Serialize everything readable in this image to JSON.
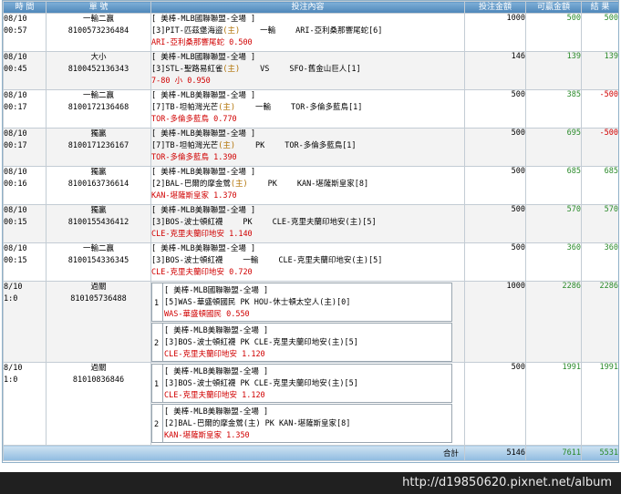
{
  "headers": {
    "time": "時 間",
    "ticket": "單 號",
    "content": "投注內容",
    "stake": "投注金額",
    "win_amount": "可贏金額",
    "result": "結 果"
  },
  "singles": [
    {
      "date": "08/10",
      "time": "00:57",
      "type": "一輸二贏",
      "ticket": "8100573236484",
      "league": "[ 美棒-MLB國聯聯盟-全場 ]",
      "match_pre": "[3]PIT-匹茲堡海盜",
      "home": "(主)",
      "match_mid": "一輸",
      "match_post": "ARI-亞利桑那響尾蛇[6]",
      "pick": "ARI-亞利桑那響尾蛇 0.500",
      "stake": "1000",
      "win": "500",
      "result": "500",
      "neg": false
    },
    {
      "date": "08/10",
      "time": "00:45",
      "type": "大小",
      "ticket": "8100452136343",
      "league": "[ 美棒-MLB國聯聯盟-全場 ]",
      "match_pre": "[3]STL-聖路易紅雀",
      "home": "(主)",
      "match_mid": "VS",
      "match_post": "SFO-舊金山巨人[1]",
      "pick": "7-80 小 0.950",
      "stake": "146",
      "win": "139",
      "result": "139",
      "neg": false
    },
    {
      "date": "08/10",
      "time": "00:17",
      "type": "一輸二贏",
      "ticket": "8100172136468",
      "league": "[ 美棒-MLB美聯聯盟-全場 ]",
      "match_pre": "[7]TB-坦帕灣光芒",
      "home": "(主)",
      "match_mid": "一輸",
      "match_post": "TOR-多倫多藍鳥[1]",
      "pick": "TOR-多倫多藍鳥 0.770",
      "stake": "500",
      "win": "385",
      "result": "-500",
      "neg": true
    },
    {
      "date": "08/10",
      "time": "00:17",
      "type": "獨贏",
      "ticket": "8100171236167",
      "league": "[ 美棒-MLB美聯聯盟-全場 ]",
      "match_pre": "[7]TB-坦帕灣光芒",
      "home": "(主)",
      "match_mid": "PK",
      "match_post": "TOR-多倫多藍鳥[1]",
      "pick": "TOR-多倫多藍鳥 1.390",
      "stake": "500",
      "win": "695",
      "result": "-500",
      "neg": true
    },
    {
      "date": "08/10",
      "time": "00:16",
      "type": "獨贏",
      "ticket": "8100163736614",
      "league": "[ 美棒-MLB美聯聯盟-全場 ]",
      "match_pre": "[2]BAL-巴爾的摩金鶯",
      "home": "(主)",
      "match_mid": "PK",
      "match_post": "KAN-堪薩斯皇家[8]",
      "pick": "KAN-堪薩斯皇家 1.370",
      "stake": "500",
      "win": "685",
      "result": "685",
      "neg": false
    },
    {
      "date": "08/10",
      "time": "00:15",
      "type": "獨贏",
      "ticket": "8100155436412",
      "league": "[ 美棒-MLB美聯聯盟-全場 ]",
      "match_pre": "[3]BOS-波士頓紅襪",
      "home": "",
      "match_mid": "PK",
      "match_post": "CLE-克里夫蘭印地安(主)[5]",
      "pick": "CLE-克里夫蘭印地安 1.140",
      "stake": "500",
      "win": "570",
      "result": "570",
      "neg": false
    },
    {
      "date": "08/10",
      "time": "00:15",
      "type": "一輸二贏",
      "ticket": "8100154336345",
      "league": "[ 美棒-MLB美聯聯盟-全場 ]",
      "match_pre": "[3]BOS-波士頓紅襪",
      "home": "",
      "match_mid": "一輸",
      "match_post": "CLE-克里夫蘭印地安(主)[5]",
      "pick": "CLE-克里夫蘭印地安 0.720",
      "stake": "500",
      "win": "360",
      "result": "360",
      "neg": false
    }
  ],
  "parlays": [
    {
      "date": "8/10",
      "sub": "1:0",
      "type": "過關",
      "ticket": "810105736488",
      "stake": "1000",
      "win": "2286",
      "result": "2286",
      "legs": [
        {
          "n": "1",
          "league": "[ 美棒-MLB國聯聯盟-全場 ]",
          "match": "[5]WAS-華盛頓國民   PK   HOU-休士頓太空人(主)[0]",
          "pick": "WAS-華盛頓國民  0.550"
        },
        {
          "n": "2",
          "league": "[ 美棒-MLB美聯聯盟-全場 ]",
          "match": "[3]BOS-波士頓紅襪   PK   CLE-克里夫蘭印地安(主)[5]",
          "pick": "CLE-克里夫蘭印地安  1.120"
        }
      ]
    },
    {
      "date": "8/10",
      "sub": "1:0",
      "type": "過關",
      "ticket": "81010836846",
      "stake": "500",
      "win": "1991",
      "result": "1991",
      "legs": [
        {
          "n": "1",
          "league": "[ 美棒-MLB美聯聯盟-全場 ]",
          "match": "[3]BOS-波士頓紅襪   PK   CLE-克里夫蘭印地安(主)[5]",
          "pick": "CLE-克里夫蘭印地安  1.120"
        },
        {
          "n": "2",
          "league": "[ 美棒-MLB美聯聯盟-全場 ]",
          "match": "[2]BAL-巴爾的摩金鶯(主)    PK    KAN-堪薩斯皇家[8]",
          "pick": "KAN-堪薩斯皇家  1.350"
        }
      ]
    }
  ],
  "totals": {
    "label": "合計",
    "stake": "5146",
    "win": "7611",
    "result": "5531"
  },
  "watermark": "http://d19850620.pixnet.net/album",
  "colors": {
    "header": "#4d86b9",
    "positive": "#2a8a2a",
    "negative": "#d00000"
  }
}
